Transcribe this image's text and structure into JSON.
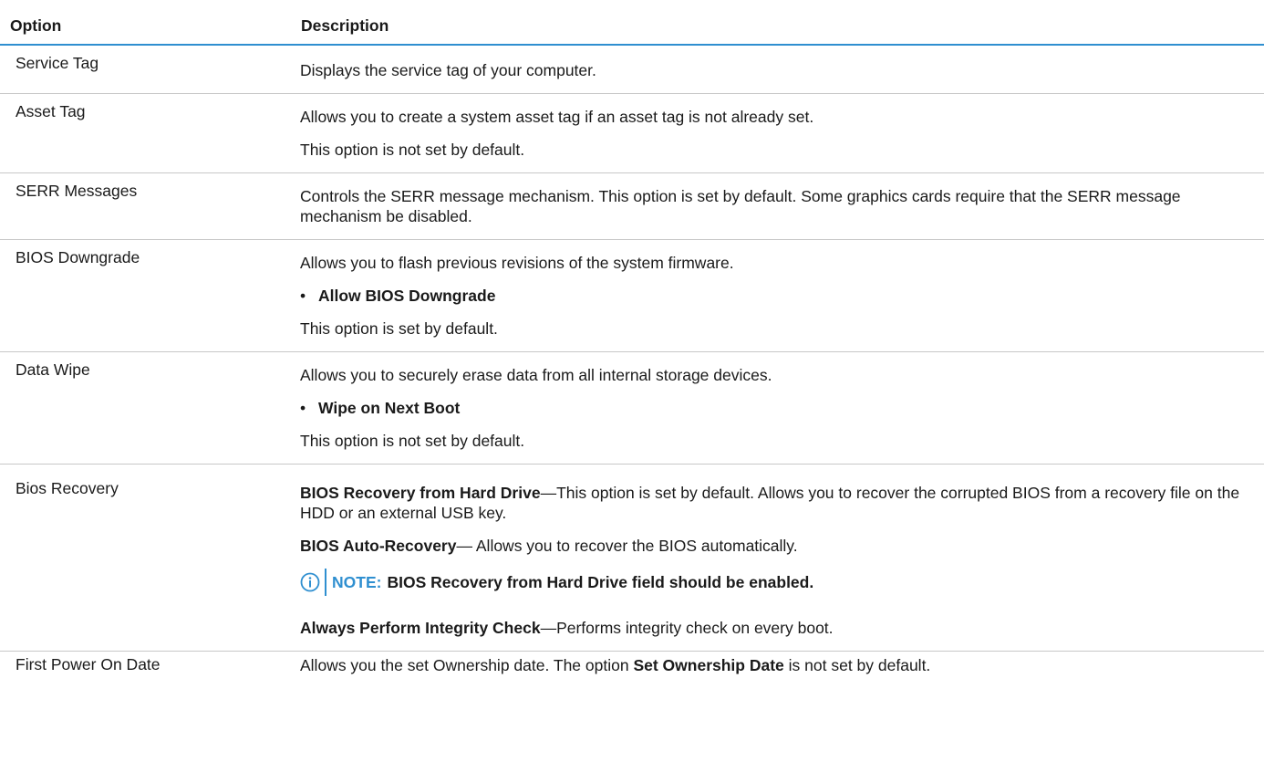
{
  "header": {
    "option": "Option",
    "description": "Description"
  },
  "rows": [
    {
      "option": "Service Tag",
      "p1": "Displays the service tag of your computer."
    },
    {
      "option": "Asset Tag",
      "p1": "Allows you to create a system asset tag if an asset tag is not already set.",
      "p2": "This option is not set by default."
    },
    {
      "option": "SERR Messages",
      "p1": "Controls the SERR message mechanism. This option is set by default. Some graphics cards require that the SERR message mechanism be disabled."
    },
    {
      "option": "BIOS Downgrade",
      "p1": "Allows you to flash previous revisions of the system firmware.",
      "bullet": "Allow BIOS Downgrade",
      "p2": "This option is set by default."
    },
    {
      "option": "Data Wipe",
      "p1": "Allows you to securely erase data from all internal storage devices.",
      "bullet": "Wipe on Next Boot",
      "p2": "This option is not set by default."
    },
    {
      "option": "Bios Recovery",
      "b1": "BIOS Recovery from Hard Drive",
      "t1": "—This option is set by default. Allows you to recover the corrupted BIOS from a recovery file on the HDD or an external USB key.",
      "b2": "BIOS Auto-Recovery",
      "t2": "— Allows you to recover the BIOS automatically.",
      "note_label": "NOTE:",
      "note_text": "BIOS Recovery from Hard Drive field should be enabled.",
      "b3": "Always Perform Integrity Check",
      "t3": "—Performs integrity check on every boot."
    },
    {
      "option": "First Power On Date",
      "t1": "Allows you the set Ownership date. The option ",
      "b1": "Set Ownership Date",
      "t2": " is not set by default."
    }
  ],
  "bullet_char": "•",
  "icons": {
    "note": "info-circle-icon"
  },
  "colors": {
    "accent": "#2f8fd0",
    "text": "#1a1a1a",
    "rule": "#c8c8c8"
  }
}
